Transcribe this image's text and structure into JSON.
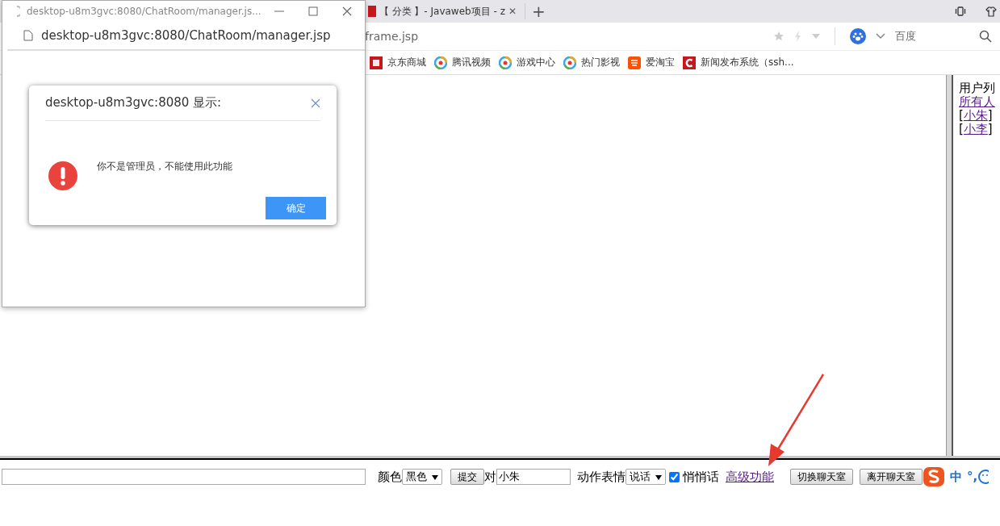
{
  "browser": {
    "tab": {
      "title": "【 分类 】- Javaweb项目 - z",
      "close": "✕",
      "new_tab": "+"
    },
    "address": "frame.jsp",
    "search_engine": "百度",
    "bookmarks": [
      {
        "kind": "jd",
        "label": "京东商城"
      },
      {
        "kind": "circle",
        "label": "腾讯视频"
      },
      {
        "kind": "circle",
        "label": "游戏中心"
      },
      {
        "kind": "circle",
        "label": "热门影视"
      },
      {
        "kind": "tao",
        "label": "爱淘宝"
      },
      {
        "kind": "c",
        "label": "新闻发布系统（ssh..."
      }
    ]
  },
  "user_list": {
    "title": "用户列",
    "all": "所有人",
    "users": [
      {
        "open": "[",
        "name": "小朱",
        "close": "]"
      },
      {
        "open": "[",
        "name": "小李",
        "close": "]"
      }
    ]
  },
  "chat_bar": {
    "color_label": "颜色",
    "color_value": "黑色",
    "submit": "提交",
    "to_label": "对",
    "to_value": "小朱",
    "action_label": "动作表情",
    "action_value": "说话",
    "whisper": {
      "label": "悄悄话",
      "checked": true
    },
    "advanced": "高级功能",
    "switch": "切换聊天室",
    "leave": "离开聊天室",
    "ime": {
      "lang": "中",
      "punct": "°,"
    }
  },
  "popup": {
    "title": "desktop-u8m3gvc:8080/ChatRoom/manager.js...",
    "address": "desktop-u8m3gvc:8080/ChatRoom/manager.jsp",
    "dialog": {
      "title": "desktop-u8m3gvc:8080 显示:",
      "message": "你不是管理员，不能使用此功能",
      "ok": "确定"
    }
  }
}
